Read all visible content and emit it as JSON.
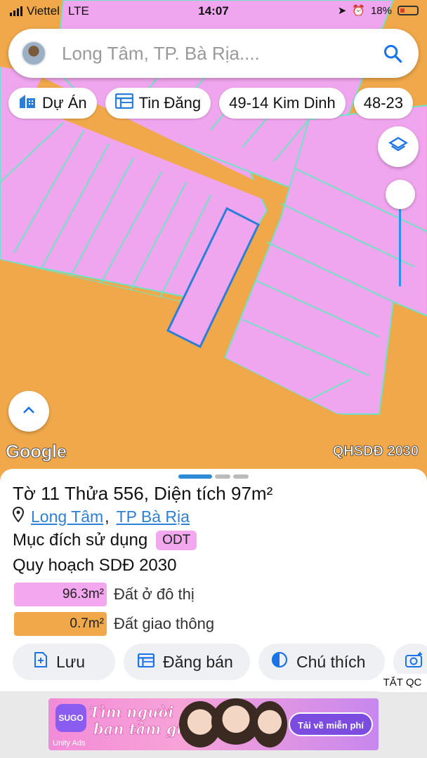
{
  "status_bar": {
    "carrier": "Viettel",
    "network": "LTE",
    "time": "14:07",
    "battery": "18%"
  },
  "search": {
    "placeholder": "Long Tâm, TP. Bà Rịa...."
  },
  "chips": [
    {
      "label": "Dự Án",
      "icon": "building-icon"
    },
    {
      "label": "Tin Đăng",
      "icon": "list-icon"
    },
    {
      "label": "49-14 Kim Dinh",
      "icon": ""
    },
    {
      "label": "48-23",
      "icon": ""
    }
  ],
  "map": {
    "brand": "Google",
    "layer_badge": "QHSDĐ 2030",
    "colors": {
      "urban_land": "#f0a6ee",
      "traffic_land": "#f0a84a",
      "selection": "#2b7fd8"
    }
  },
  "parcel": {
    "title": "Tờ 11 Thửa 556, Diện tích 97m²",
    "ward": "Long Tâm",
    "city": "TP Bà Rịa",
    "purpose_label": "Mục đích sử dụng",
    "purpose_code": "ODT",
    "plan_label": "Quy hoạch SDĐ 2030",
    "areas": [
      {
        "value": "96.3m²",
        "label": "Đất ở đô thị",
        "color": "#f2a7ef"
      },
      {
        "value": "0.7m²",
        "label": "Đất giao thông",
        "color": "#f0a84a"
      }
    ]
  },
  "actions": {
    "save": "Lưu",
    "post_sale": "Đăng bán",
    "legend": "Chú thích"
  },
  "ad": {
    "close_label": "TẮT QC",
    "brand": "SUGO",
    "headline_1": "Tìm người",
    "headline_2": "bạn tâm giao",
    "cta": "Tải về miễn phí",
    "network": "Unity Ads"
  }
}
